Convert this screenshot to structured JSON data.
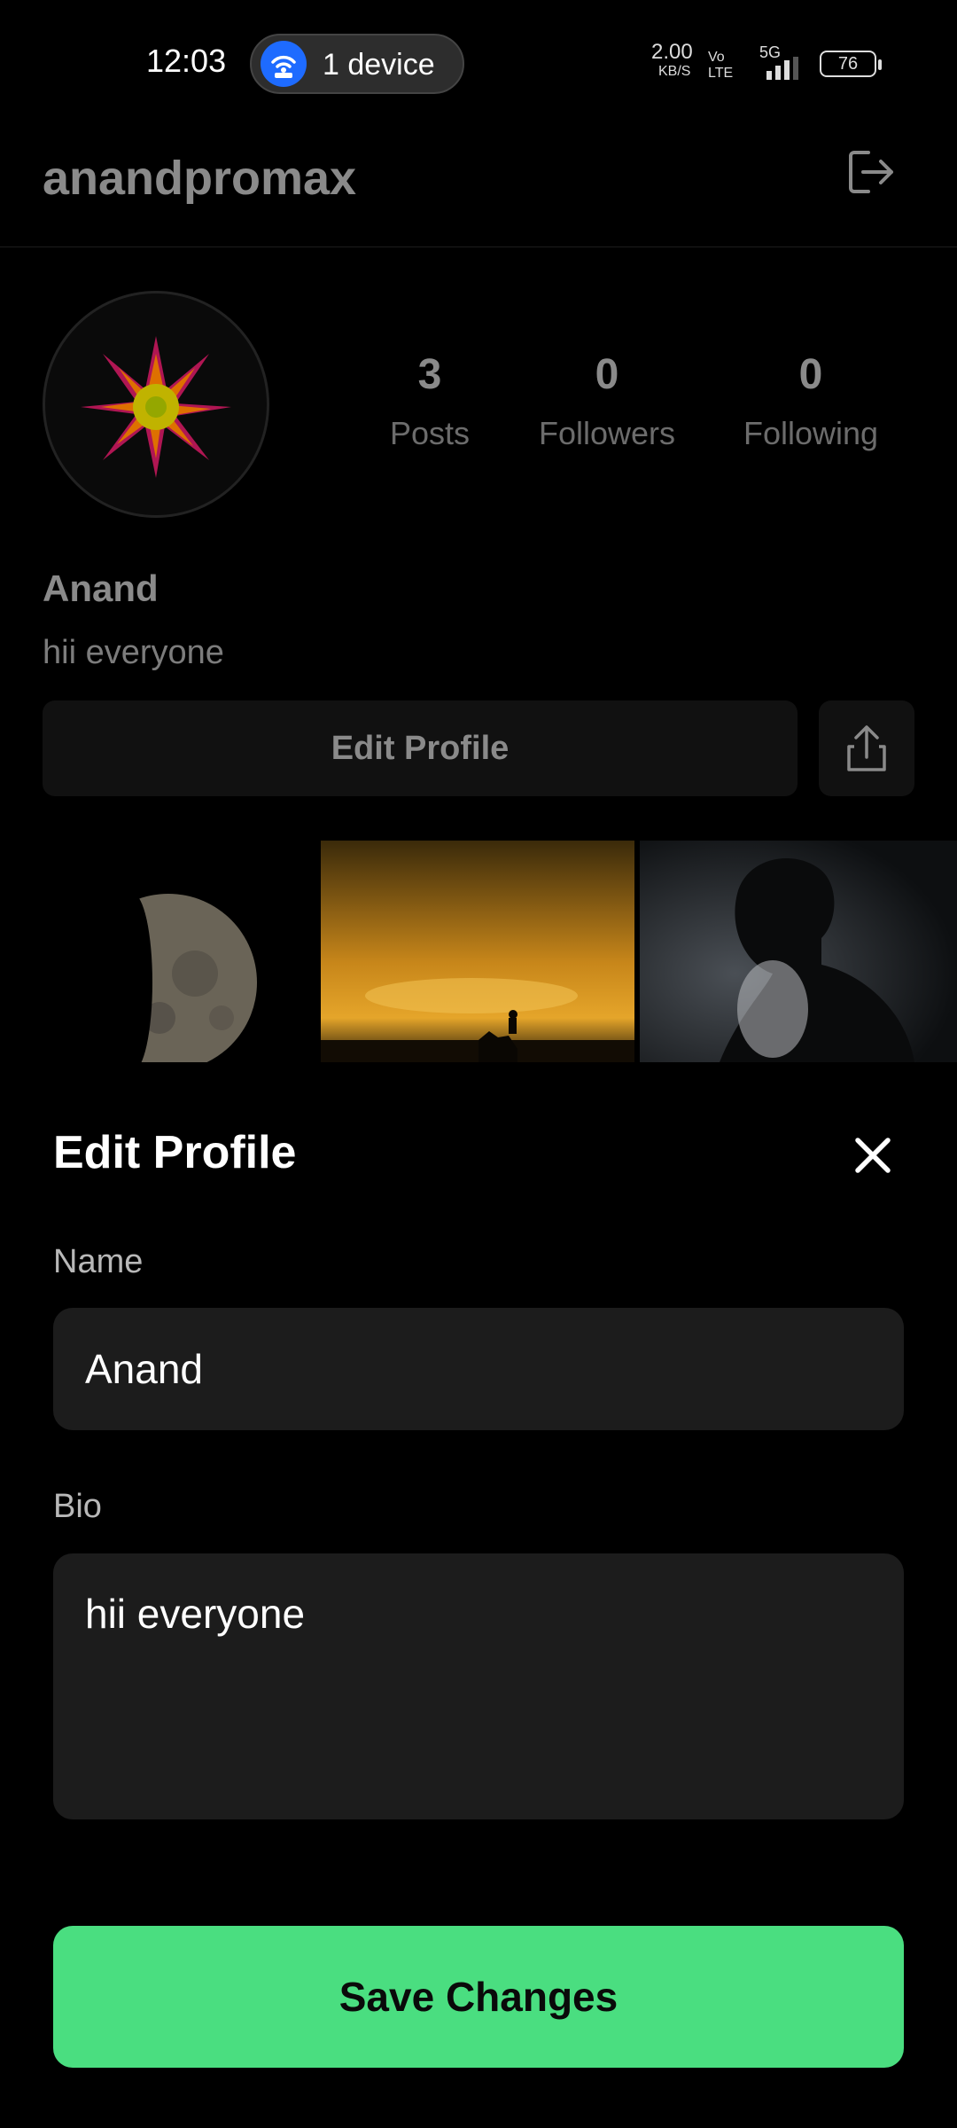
{
  "status_bar": {
    "time": "12:03",
    "hotspot_label": "1 device",
    "net_speed": "2.00",
    "net_unit": "KB/S",
    "volte": "Vo LTE",
    "network": "5G",
    "battery": "76"
  },
  "profile": {
    "username": "anandpromax",
    "stats": [
      {
        "value": "3",
        "label": "Posts"
      },
      {
        "value": "0",
        "label": "Followers"
      },
      {
        "value": "0",
        "label": "Following"
      }
    ],
    "display_name": "Anand",
    "bio": "hii everyone",
    "edit_profile_label": "Edit Profile"
  },
  "sheet": {
    "title": "Edit Profile",
    "name_label": "Name",
    "name_value": "Anand",
    "bio_label": "Bio",
    "bio_value": "hii everyone",
    "save_label": "Save Changes"
  },
  "colors": {
    "accent": "#4ade80",
    "field_bg": "#1c1c1c",
    "hotspot_blue": "#1e6bff"
  },
  "icons": [
    "wifi-hotspot-icon",
    "signal-icon",
    "battery-icon",
    "logout-icon",
    "share-icon",
    "close-icon"
  ]
}
